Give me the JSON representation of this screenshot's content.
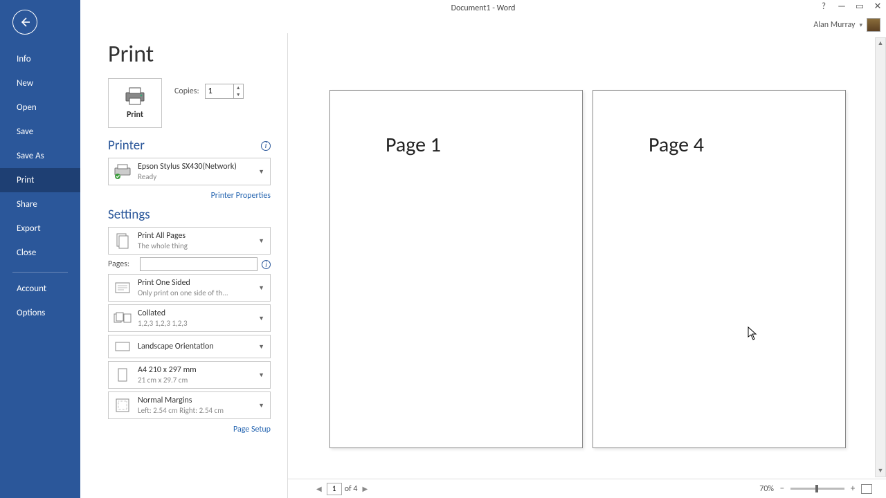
{
  "window": {
    "title": "Document1 - Word"
  },
  "user": {
    "name": "Alan Murray"
  },
  "sidebar": {
    "items": [
      "Info",
      "New",
      "Open",
      "Save",
      "Save As",
      "Print",
      "Share",
      "Export",
      "Close"
    ],
    "bottom": [
      "Account",
      "Options"
    ],
    "active_index": 5
  },
  "page": {
    "title": "Print",
    "print_label": "Print",
    "copies_label": "Copies:",
    "copies_value": "1"
  },
  "printer": {
    "heading": "Printer",
    "name": "Epson Stylus SX430(Network)",
    "status": "Ready",
    "properties_link": "Printer Properties"
  },
  "settings": {
    "heading": "Settings",
    "print_scope": {
      "t1": "Print All Pages",
      "t2": "The whole thing"
    },
    "pages_label": "Pages:",
    "pages_value": "",
    "sides": {
      "t1": "Print One Sided",
      "t2": "Only print on one side of th..."
    },
    "collate": {
      "t1": "Collated",
      "t2": "1,2,3    1,2,3    1,2,3"
    },
    "orientation": {
      "t1": "Landscape Orientation"
    },
    "paper": {
      "t1": "A4 210 x 297 mm",
      "t2": "21 cm x 29.7 cm"
    },
    "margins": {
      "t1": "Normal Margins",
      "t2": "Left:  2.54 cm    Right:  2.54 cm"
    },
    "page_setup_link": "Page Setup"
  },
  "preview": {
    "pages": [
      "Page 1",
      "Page 4"
    ],
    "nav_current": "1",
    "nav_total": "of 4",
    "zoom_label": "70%"
  }
}
